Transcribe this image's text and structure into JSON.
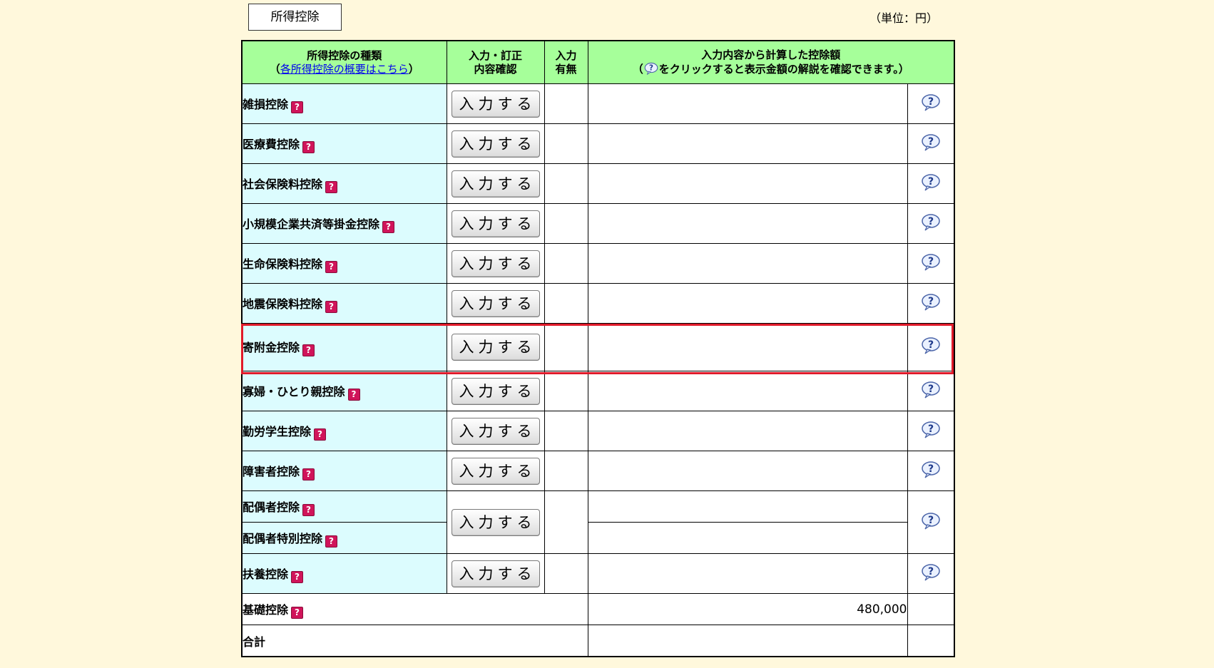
{
  "header": {
    "tab_label": "所得控除",
    "unit": "（単位：円）"
  },
  "table": {
    "col1_title": "所得控除の種類",
    "col1_link": "各所得控除の概要はこちら",
    "col1_open": "（",
    "col1_close": "）",
    "col2_title1": "入力・訂正",
    "col2_title2": "内容確認",
    "col3_title1": "入力",
    "col3_title2": "有無",
    "col4_title1": "入力内容から計算した控除額",
    "col4_open": "（",
    "col4_title2": "をクリックすると表示金額の解説を確認できます。）"
  },
  "button_label": "入力する",
  "rows": [
    {
      "name": "雑損控除"
    },
    {
      "name": "医療費控除"
    },
    {
      "name": "社会保険料控除"
    },
    {
      "name": "小規模企業共済等掛金控除"
    },
    {
      "name": "生命保険料控除"
    },
    {
      "name": "地震保険料控除"
    },
    {
      "name": "寄附金控除"
    },
    {
      "name": "寡婦・ひとり親控除"
    },
    {
      "name": "勤労学生控除"
    },
    {
      "name": "障害者控除"
    },
    {
      "name": "配偶者控除"
    },
    {
      "name": "配偶者特別控除"
    },
    {
      "name": "扶養控除"
    }
  ],
  "basic": {
    "name": "基礎控除",
    "amount": "480,000"
  },
  "total": {
    "name": "合計"
  },
  "icons": {
    "small_help": "help-square-icon",
    "bubble_help": "help-bubble-icon"
  },
  "colors": {
    "background": "#fff8dc",
    "header_green": "#a6ff9a",
    "name_cyan": "#dcfcfe",
    "help_magenta": "#d0145a",
    "highlight_red": "#e01a2a"
  }
}
